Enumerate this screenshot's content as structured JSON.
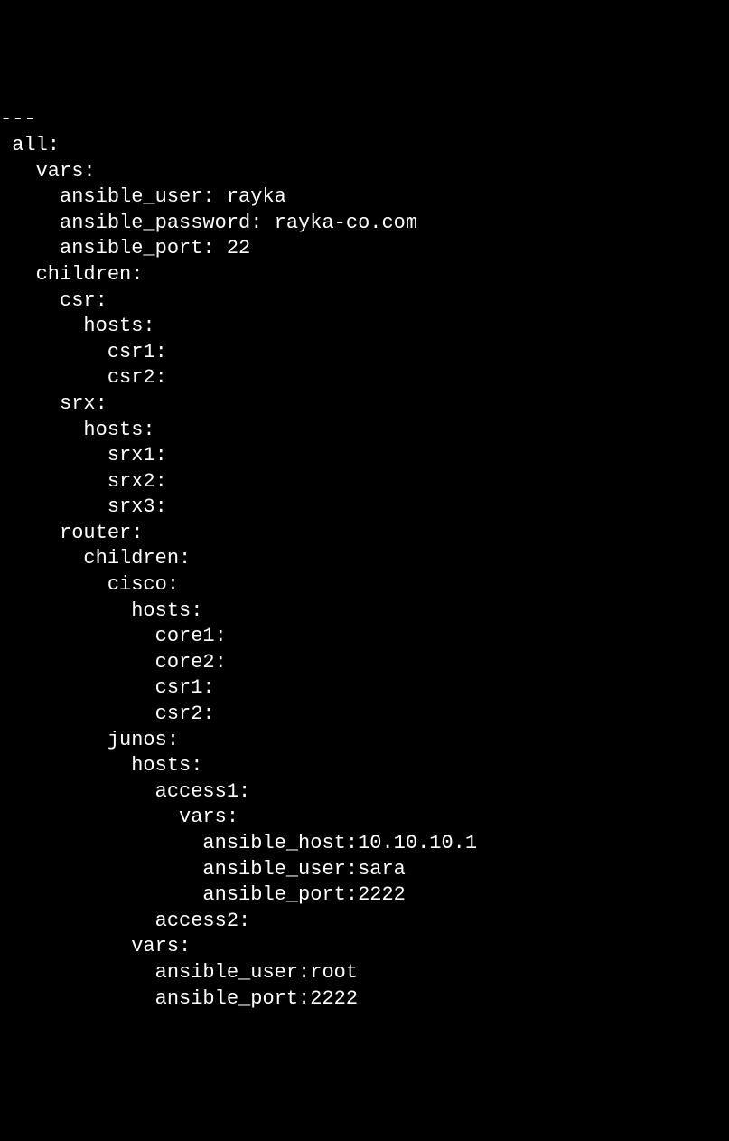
{
  "lines": [
    "---",
    " all:",
    "   vars:",
    "     ansible_user: rayka",
    "     ansible_password: rayka-co.com",
    "     ansible_port: 22",
    "   children:",
    "     csr:",
    "       hosts:",
    "         csr1:",
    "         csr2:",
    "     srx:",
    "       hosts:",
    "         srx1:",
    "         srx2:",
    "         srx3:",
    "     router:",
    "       children:",
    "         cisco:",
    "           hosts:",
    "             core1:",
    "             core2:",
    "             csr1:",
    "             csr2:",
    "         junos:",
    "           hosts:",
    "             access1:",
    "               vars:",
    "                 ansible_host:10.10.10.1",
    "                 ansible_user:sara",
    "                 ansible_port:2222",
    "             access2:",
    "           vars:",
    "             ansible_user:root",
    "             ansible_port:2222"
  ]
}
